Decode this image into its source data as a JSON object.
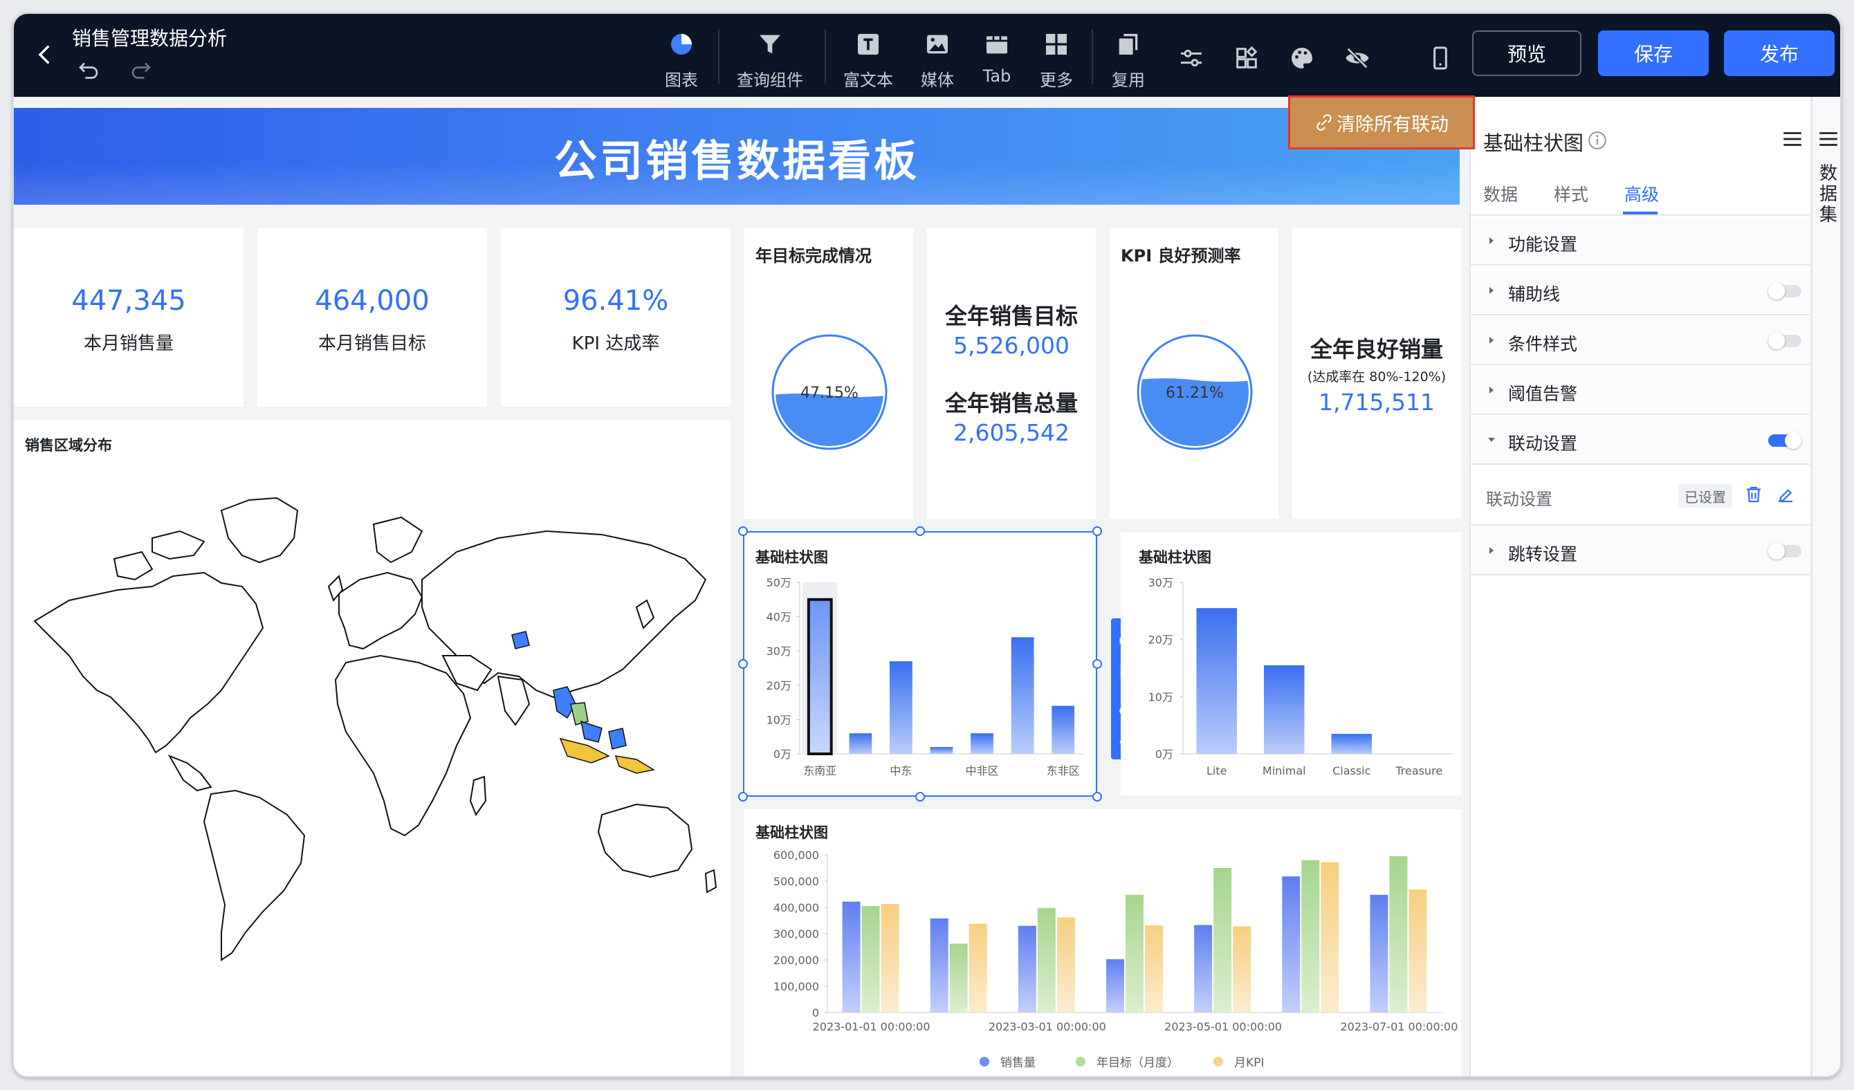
{
  "topbar": {
    "title": "销售管理数据分析",
    "tools": [
      {
        "label": "图表",
        "icon": "pie-chart-icon"
      },
      {
        "label": "查询组件",
        "icon": "filter-icon"
      },
      {
        "label": "富文本",
        "icon": "text-icon"
      },
      {
        "label": "媒体",
        "icon": "image-icon"
      },
      {
        "label": "Tab",
        "icon": "tab-icon"
      },
      {
        "label": "更多",
        "icon": "grid-icon"
      },
      {
        "label": "复用",
        "icon": "copy-icon"
      }
    ],
    "preview_label": "预览",
    "save_label": "保存",
    "publish_label": "发布"
  },
  "banner": {
    "title": "公司销售数据看板"
  },
  "clear_link_label": "清除所有联动",
  "kpis": [
    {
      "value": "447,345",
      "label": "本月销售量"
    },
    {
      "value": "464,000",
      "label": "本月销售目标"
    },
    {
      "value": "96.41%",
      "label": "KPI 达成率"
    }
  ],
  "gauge1": {
    "title": "年目标完成情况",
    "text": "47.15%",
    "fill": 0.4715
  },
  "targets": {
    "label1": "全年销售目标",
    "value1": "5,526,000",
    "label2": "全年销售总量",
    "value2": "2,605,542"
  },
  "gauge2": {
    "title": "KPI 良好预测率",
    "text": "61.21%",
    "fill": 0.6121
  },
  "good_sales": {
    "label": "全年良好销量",
    "sub": "(达成率在 80%-120%)",
    "value": "1,715,511"
  },
  "map": {
    "title": "销售区域分布"
  },
  "colors": {
    "accent": "#3370ff",
    "bar_blue": "#4b7cf0",
    "bar_green": "#9fd08a",
    "bar_yellow": "#f6d28a",
    "clear_btn": "#c98f50"
  },
  "chart_data": [
    {
      "type": "bar",
      "title": "基础柱状图",
      "categories": [
        "东南亚",
        "",
        "中东",
        "",
        "中非区",
        "",
        "东非区"
      ],
      "tick_categories": [
        "东南亚",
        "中东",
        "中非区",
        "东非区"
      ],
      "values": [
        45,
        6,
        27,
        2,
        6,
        34,
        14
      ],
      "ylim": [
        0,
        50
      ],
      "yticks": [
        "0万",
        "10万",
        "20万",
        "30万",
        "40万",
        "50万"
      ],
      "highlight_index": 0
    },
    {
      "type": "bar",
      "title": "基础柱状图",
      "categories": [
        "Lite",
        "Minimal",
        "Classic",
        "Treasure"
      ],
      "values": [
        25.5,
        15.5,
        3.5,
        0
      ],
      "ylim": [
        0,
        30
      ],
      "yticks": [
        "0万",
        "10万",
        "20万",
        "30万"
      ]
    },
    {
      "type": "bar",
      "title": "基础柱状图",
      "x": [
        "2023-01-01 00:00:00",
        "",
        "2023-03-01 00:00:00",
        "",
        "2023-05-01 00:00:00",
        "",
        "2023-07-01 00:00:00"
      ],
      "series": [
        {
          "name": "销售量",
          "values": [
            422000,
            358000,
            330000,
            203000,
            333000,
            518000,
            448000
          ]
        },
        {
          "name": "年目标（月度）",
          "values": [
            405000,
            262000,
            398000,
            448000,
            550000,
            580000,
            595000
          ]
        },
        {
          "name": "月KPI",
          "values": [
            413000,
            338000,
            362000,
            332000,
            328000,
            572000,
            468000
          ]
        }
      ],
      "ylim": [
        0,
        600000
      ],
      "yticks": [
        "0",
        "100,000",
        "200,000",
        "300,000",
        "400,000",
        "500,000",
        "600,000"
      ]
    }
  ],
  "panel": {
    "title": "基础柱状图",
    "tabs": [
      "数据",
      "样式",
      "高级"
    ],
    "sections": [
      {
        "label": "功能设置",
        "toggle": null
      },
      {
        "label": "辅助线",
        "toggle": false
      },
      {
        "label": "条件样式",
        "toggle": false
      },
      {
        "label": "阈值告警",
        "toggle": null
      },
      {
        "label": "联动设置",
        "toggle": true
      }
    ],
    "link_row": {
      "label": "联动设置",
      "tag": "已设置"
    },
    "jump": {
      "label": "跳转设置",
      "toggle": false
    }
  },
  "dataset_rail": {
    "label": "数据集"
  }
}
